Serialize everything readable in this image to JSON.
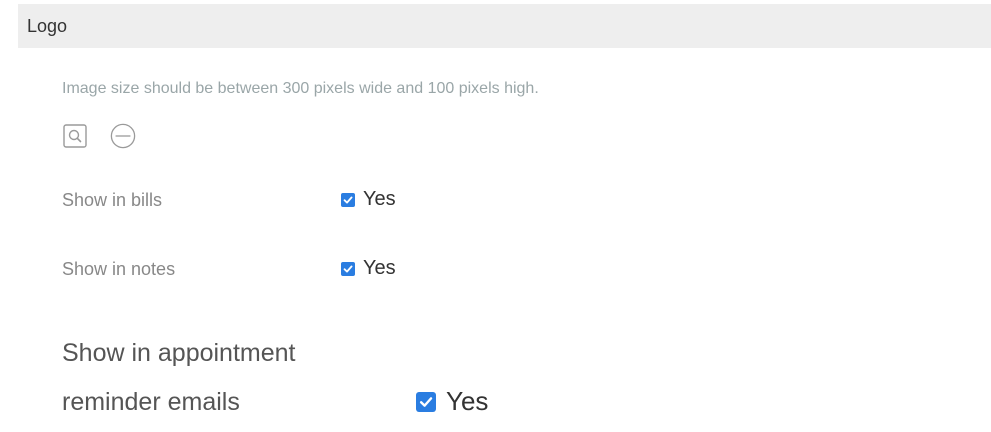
{
  "section": {
    "title": "Logo"
  },
  "logo": {
    "hint": "Image size should be between 300 pixels wide and 100 pixels high.",
    "icons": [
      "search-icon",
      "minus-circle-icon"
    ]
  },
  "options": {
    "bills": {
      "label": "Show in bills",
      "checked": true,
      "value_label": "Yes"
    },
    "notes": {
      "label": "Show in notes",
      "checked": true,
      "value_label": "Yes"
    },
    "reminders": {
      "label_line1": "Show in appointment",
      "label_line2": "reminder emails",
      "checked": true,
      "value_label": "Yes"
    }
  },
  "colors": {
    "header_bg": "#eeeeee",
    "checkbox": "#2a7de1",
    "hint_text": "#9aa6a8"
  }
}
